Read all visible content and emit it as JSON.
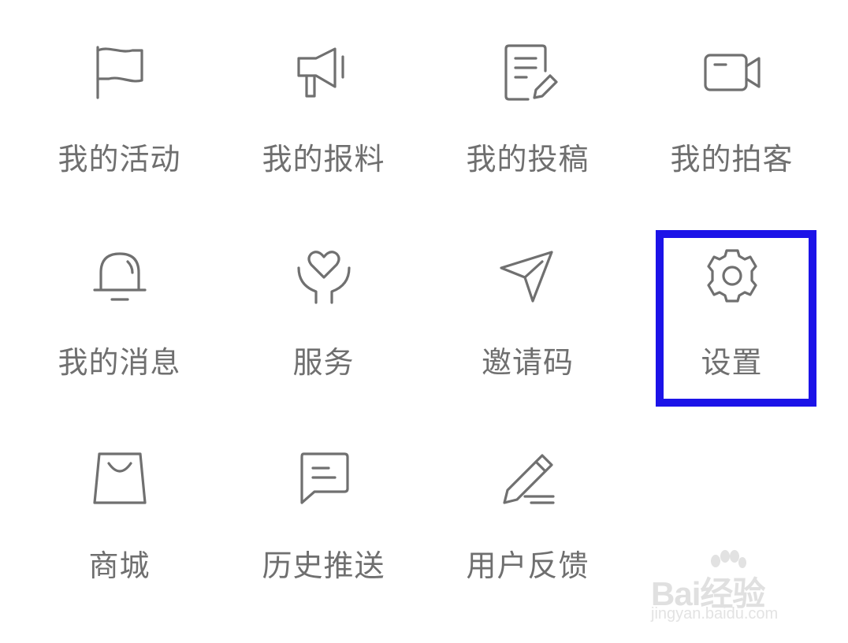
{
  "menu": {
    "items": [
      {
        "label": "我的活动",
        "icon": "flag-icon"
      },
      {
        "label": "我的报料",
        "icon": "megaphone-icon"
      },
      {
        "label": "我的投稿",
        "icon": "document-edit-icon"
      },
      {
        "label": "我的拍客",
        "icon": "video-camera-icon"
      },
      {
        "label": "我的消息",
        "icon": "bell-icon"
      },
      {
        "label": "服务",
        "icon": "heart-hands-icon"
      },
      {
        "label": "邀请码",
        "icon": "send-icon"
      },
      {
        "label": "设置",
        "icon": "gear-icon"
      },
      {
        "label": "商城",
        "icon": "shopping-bag-icon"
      },
      {
        "label": "历史推送",
        "icon": "message-icon"
      },
      {
        "label": "用户反馈",
        "icon": "pencil-icon"
      }
    ]
  },
  "colors": {
    "icon_stroke": "#707070",
    "label_text": "#6f6f6f",
    "highlight_border": "#1c13e8",
    "background": "#ffffff"
  },
  "highlighted_item": "设置",
  "watermark": {
    "logo": "Bai经验",
    "url": "jingyan.baidu.com"
  }
}
